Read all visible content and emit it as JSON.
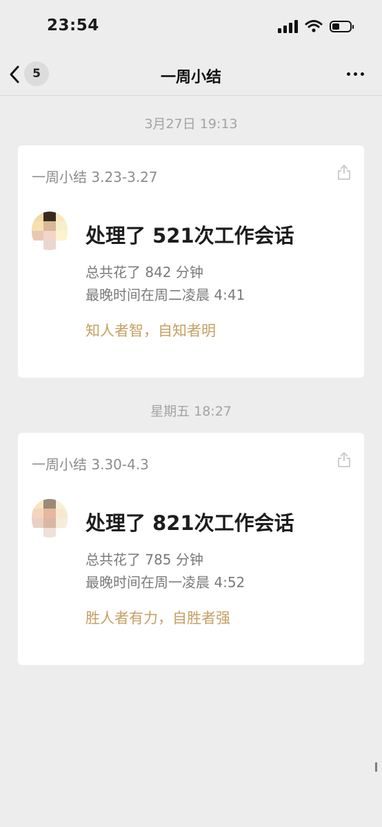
{
  "status_bar": {
    "time": "23:54"
  },
  "nav": {
    "unread_count": "5",
    "title": "一周小结"
  },
  "messages": [
    {
      "timestamp": "3月27日 19:13",
      "header": "一周小结 3.23-3.27",
      "headline": "处理了 521次工作会话",
      "total_time": "总共花了 842 分钟",
      "latest_time": "最晚时间在周二凌晨 4:41",
      "quote": "知人者智，自知者明"
    },
    {
      "timestamp": "星期五 18:27",
      "header": "一周小结 3.30-4.3",
      "headline": "处理了 821次工作会话",
      "total_time": "总共花了 785 分钟",
      "latest_time": "最晚时间在周一凌晨 4:52",
      "quote": "胜人者有力，自胜者强"
    }
  ],
  "colors": {
    "accent_quote": "#c5a063",
    "background": "#ededed"
  }
}
